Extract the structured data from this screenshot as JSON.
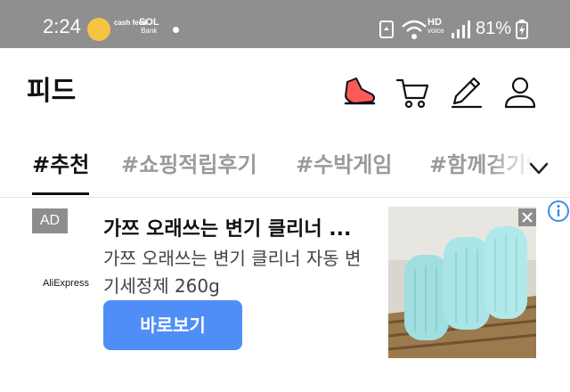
{
  "status_bar": {
    "time": "2:24",
    "cashfeed_label": "cash feed",
    "sol_label": "SOL",
    "bank_label": "Bank",
    "network_label": "HD",
    "network_sub": "voice",
    "battery": "81%"
  },
  "header": {
    "title": "피드"
  },
  "tabs": [
    {
      "label": "#추천"
    },
    {
      "label": "#쇼핑적립후기"
    },
    {
      "label": "#수박게임"
    },
    {
      "label": "#함께걷기인증"
    }
  ],
  "ad": {
    "badge": "AD",
    "brand": "AliExpress",
    "title": "가쯔 오래쓰는 변기 클리너 ...",
    "description": "가쯔 오래쓰는 변기 클리너 자동 변기세정제 260g",
    "button_label": "바로보기"
  },
  "colors": {
    "status_bar_bg": "#8f8f8f",
    "accent_button": "#4f8ef7",
    "info_icon": "#3a8ee6"
  }
}
